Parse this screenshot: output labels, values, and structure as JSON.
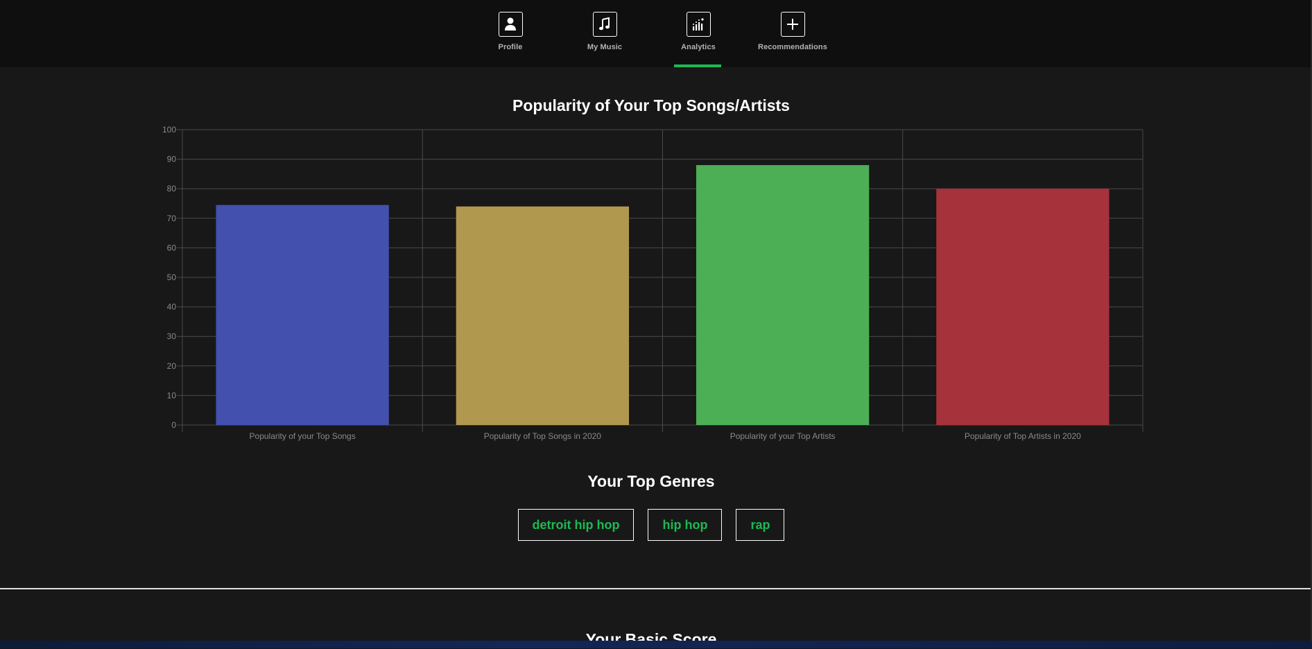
{
  "nav": {
    "items": [
      {
        "label": "Profile",
        "icon": "user-icon"
      },
      {
        "label": "My Music",
        "icon": "music-note-icon"
      },
      {
        "label": "Analytics",
        "icon": "bar-chart-icon",
        "active": true
      },
      {
        "label": "Recommendations",
        "icon": "plus-icon"
      }
    ],
    "accent_color": "#1db954"
  },
  "popularity_section": {
    "title": "Popularity of Your Top Songs/Artists"
  },
  "chart_data": {
    "type": "bar",
    "title": "Popularity of Your Top Songs/Artists",
    "categories": [
      "Popularity of your Top Songs",
      "Popularity of Top Songs in 2020",
      "Popularity of your Top Artists",
      "Popularity of Top Artists in 2020"
    ],
    "values": [
      74.5,
      74,
      88,
      80
    ],
    "colors": [
      "#4450ae",
      "#b0984e",
      "#4caf55",
      "#a6323b"
    ],
    "ylim": [
      0,
      100
    ],
    "yticks": [
      "0",
      "10",
      "20",
      "30",
      "40",
      "50",
      "60",
      "70",
      "80",
      "90",
      "100"
    ],
    "grid": true,
    "legend": "none"
  },
  "genres_section": {
    "title": "Your Top Genres",
    "genres": [
      "detroit hip hop",
      "hip hop",
      "rap"
    ]
  },
  "basic_score_section": {
    "title": "Your Basic Score"
  }
}
